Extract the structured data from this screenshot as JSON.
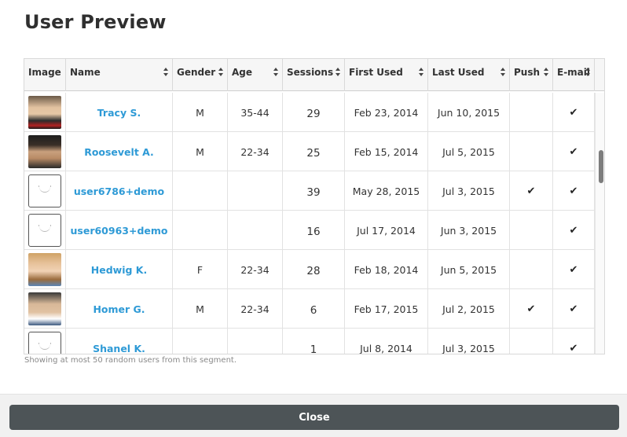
{
  "title": "User Preview",
  "columns": [
    {
      "label": "Image",
      "sortable": false
    },
    {
      "label": "Name",
      "sortable": true
    },
    {
      "label": "Gender",
      "sortable": true
    },
    {
      "label": "Age",
      "sortable": true
    },
    {
      "label": "Sessions",
      "sortable": true
    },
    {
      "label": "First Used",
      "sortable": true
    },
    {
      "label": "Last Used",
      "sortable": true
    },
    {
      "label": "Push",
      "sortable": true
    },
    {
      "label": "E-mail",
      "sortable": true
    }
  ],
  "rows": [
    {
      "avatar": "photo",
      "name": "Tracy S.",
      "gender": "M",
      "age": "35-44",
      "sessions": "29",
      "first_used": "Feb 23, 2014",
      "last_used": "Jun 10, 2015",
      "push": "",
      "email": "✔"
    },
    {
      "avatar": "photo",
      "name": "Roosevelt A.",
      "gender": "M",
      "age": "22-34",
      "sessions": "25",
      "first_used": "Feb 15, 2014",
      "last_used": "Jul 5, 2015",
      "push": "",
      "email": "✔"
    },
    {
      "avatar": "placeholder",
      "name": "user6786+demo",
      "gender": "",
      "age": "",
      "sessions": "39",
      "first_used": "May 28, 2015",
      "last_used": "Jul 3, 2015",
      "push": "✔",
      "email": "✔"
    },
    {
      "avatar": "placeholder",
      "name": "user60963+demo",
      "gender": "",
      "age": "",
      "sessions": "16",
      "first_used": "Jul 17, 2014",
      "last_used": "Jun 3, 2015",
      "push": "",
      "email": "✔"
    },
    {
      "avatar": "photo",
      "name": "Hedwig K.",
      "gender": "F",
      "age": "22-34",
      "sessions": "28",
      "first_used": "Feb 18, 2014",
      "last_used": "Jun 5, 2015",
      "push": "",
      "email": "✔"
    },
    {
      "avatar": "photo",
      "name": "Homer G.",
      "gender": "M",
      "age": "22-34",
      "sessions": "6",
      "first_used": "Feb 17, 2015",
      "last_used": "Jul 2, 2015",
      "push": "✔",
      "email": "✔"
    },
    {
      "avatar": "placeholder",
      "name": "Shanel K.",
      "gender": "",
      "age": "",
      "sessions": "1",
      "first_used": "Jul 8, 2014",
      "last_used": "Jul 3, 2015",
      "push": "",
      "email": "✔"
    }
  ],
  "note": "Showing at most 50 random users from this segment.",
  "close_label": "Close",
  "colors": {
    "link": "#2e9ad6",
    "button": "#4d5457",
    "header_bg": "#f6f6f6"
  }
}
